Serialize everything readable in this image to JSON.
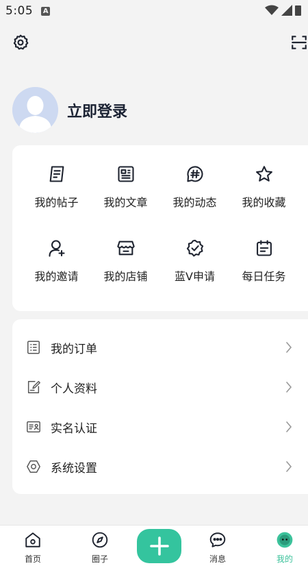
{
  "status_bar": {
    "time": "5:05",
    "a_icon": "A"
  },
  "top_bar": {
    "left_icon": "gear-icon",
    "right_icon": "scan-icon"
  },
  "profile": {
    "login_label": "立即登录"
  },
  "grid": [
    {
      "label": "我的帖子",
      "icon": "post-icon"
    },
    {
      "label": "我的文章",
      "icon": "article-icon"
    },
    {
      "label": "我的动态",
      "icon": "hashtag-icon"
    },
    {
      "label": "我的收藏",
      "icon": "star-icon"
    },
    {
      "label": "我的邀请",
      "icon": "user-add-icon"
    },
    {
      "label": "我的店铺",
      "icon": "store-icon"
    },
    {
      "label": "蓝V申请",
      "icon": "verified-badge-icon"
    },
    {
      "label": "每日任务",
      "icon": "calendar-task-icon"
    }
  ],
  "list": [
    {
      "label": "我的订单",
      "icon": "order-icon"
    },
    {
      "label": "个人资料",
      "icon": "edit-profile-icon"
    },
    {
      "label": "实名认证",
      "icon": "id-card-icon"
    },
    {
      "label": "系统设置",
      "icon": "hexagon-settings-icon"
    }
  ],
  "bottom_nav": {
    "items": [
      {
        "label": "首页",
        "icon": "home-icon"
      },
      {
        "label": "圈子",
        "icon": "compass-icon"
      },
      {
        "label": "消息",
        "icon": "message-icon"
      },
      {
        "label": "我的",
        "icon": "profile-face-icon"
      }
    ],
    "active": "我的",
    "fab_icon": "plus-icon"
  },
  "colors": {
    "accent": "#34c49e",
    "active_text": "#3cc29b",
    "background": "#f3f3f3",
    "card": "#ffffff"
  }
}
